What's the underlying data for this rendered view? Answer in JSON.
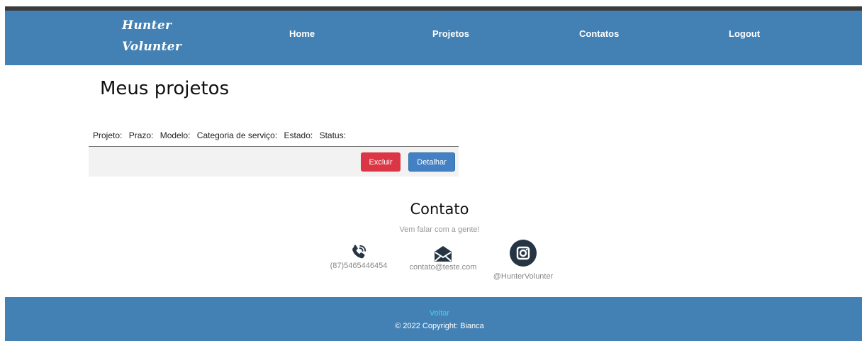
{
  "header": {
    "logo_line1": "Hunter",
    "logo_line2": "Volunter",
    "nav": [
      {
        "label": "Home"
      },
      {
        "label": "Projetos"
      },
      {
        "label": "Contatos"
      },
      {
        "label": "Logout"
      }
    ]
  },
  "main": {
    "title": "Meus projetos",
    "columns": [
      "Projeto:",
      "Prazo:",
      "Modelo:",
      "Categoria de serviço:",
      "Estado:",
      "Status:"
    ],
    "actions": {
      "delete_label": "Excluir",
      "detail_label": "Detalhar"
    }
  },
  "contact": {
    "title": "Contato",
    "subtitle": "Vem falar com a gente!",
    "phone": "(87)5465446454",
    "email": "contato@teste.com",
    "instagram": "@HunterVolunter",
    "icons": [
      "phone-icon",
      "envelope-icon",
      "instagram-icon"
    ]
  },
  "footer": {
    "back_label": "Voltar",
    "copyright": "© 2022 Copyright: Bianca"
  },
  "colors": {
    "navbar": "#4380b4",
    "danger": "#dc3545",
    "primary": "#4380c4",
    "footer_link": "#3fd6f0",
    "icon_dark": "#263544"
  }
}
